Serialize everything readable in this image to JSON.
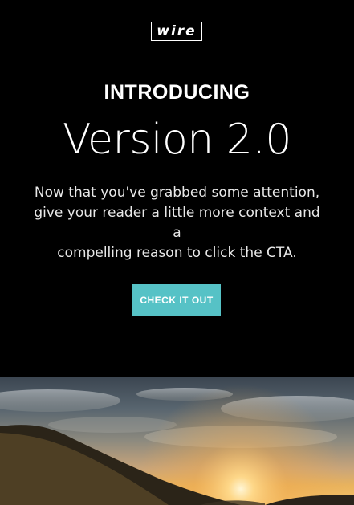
{
  "logo": {
    "text": "wire"
  },
  "hero": {
    "eyebrow": "INTRODUCING",
    "headline": "Version 2.0",
    "body_lines": [
      "Now that you've grabbed some attention,",
      "give your reader a little more context and a",
      "compelling reason to click the CTA."
    ],
    "cta_label": "CHECK IT OUT"
  },
  "colors": {
    "background": "#000000",
    "cta": "#56c2c6",
    "text": "#ffffff"
  },
  "image": {
    "subject": "sunset-over-hills-photo"
  }
}
